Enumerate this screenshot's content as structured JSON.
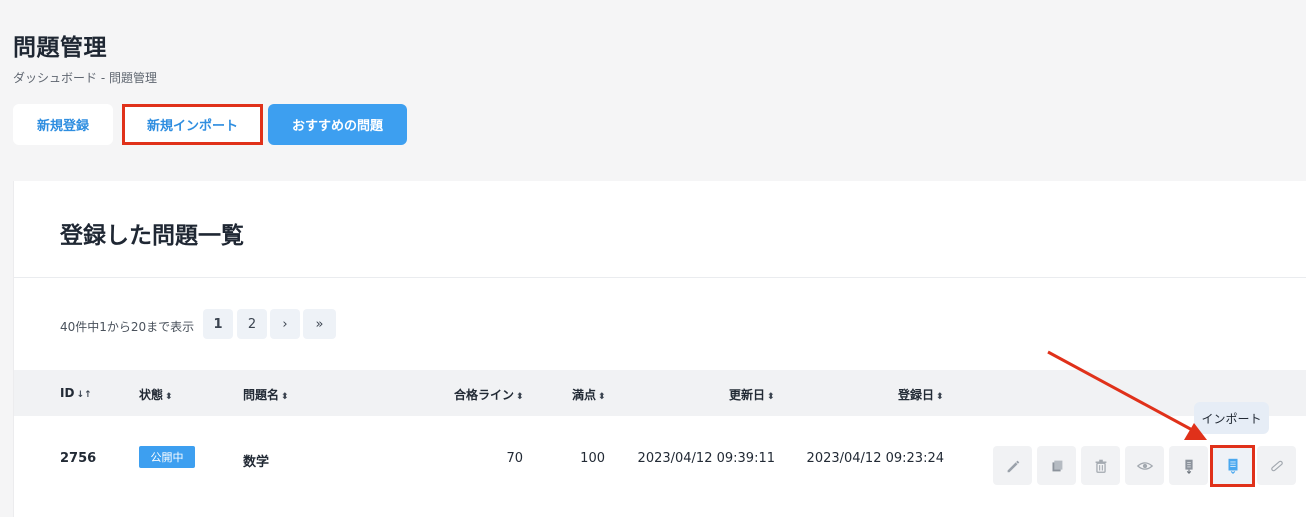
{
  "header": {
    "title": "問題管理",
    "breadcrumb": "ダッシュボード - 問題管理"
  },
  "actions": {
    "new_label": "新規登録",
    "import_label": "新規インポート",
    "recommend_label": "おすすめの問題"
  },
  "card": {
    "title": "登録した問題一覧"
  },
  "pagination": {
    "info": "40件中1から20まで表示",
    "pages": [
      "1",
      "2"
    ],
    "next": "›",
    "last": "»"
  },
  "table": {
    "columns": {
      "id": "ID",
      "status": "状態",
      "name": "問題名",
      "pass_line": "合格ライン",
      "full_score": "満点",
      "updated": "更新日",
      "registered": "登録日"
    },
    "rows": [
      {
        "id": "2756",
        "status": "公開中",
        "name": "数学",
        "pass_line": "70",
        "full_score": "100",
        "updated": "2023/04/12 09:39:11",
        "registered": "2023/04/12 09:23:24"
      }
    ]
  },
  "row_actions": [
    "pencil-icon",
    "copy-icon",
    "trash-icon",
    "eye-icon",
    "export-icon",
    "import-icon",
    "link-icon"
  ],
  "tooltip": "インポート",
  "colors": {
    "primary": "#3d9ff0",
    "highlight": "#e0311a"
  }
}
